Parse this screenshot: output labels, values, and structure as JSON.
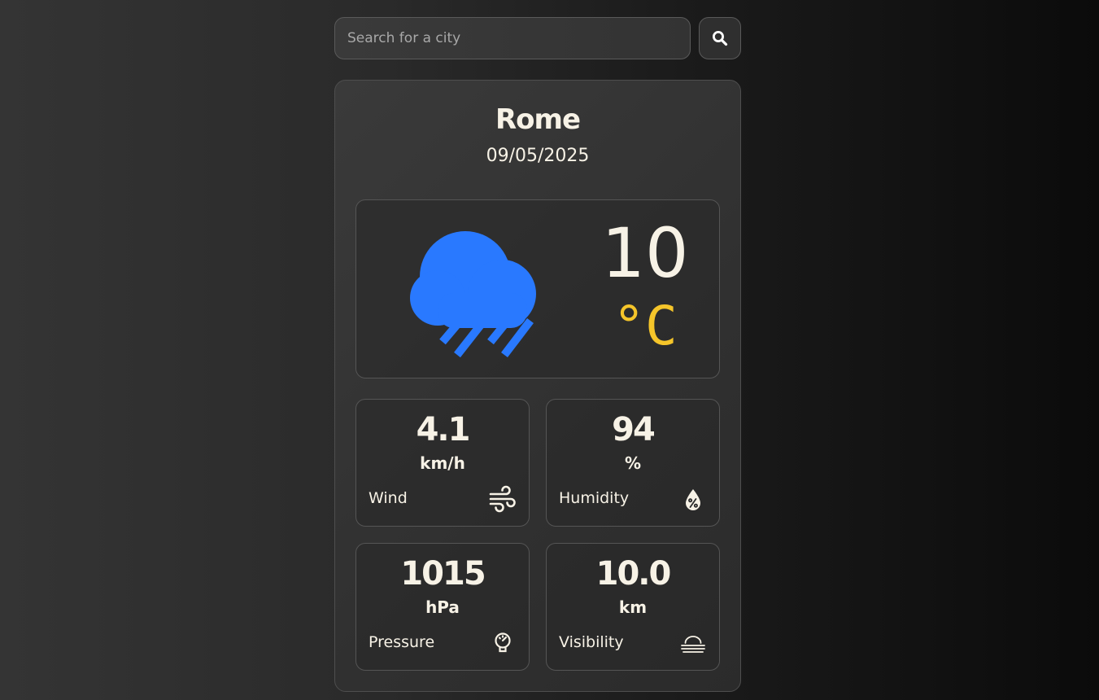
{
  "search": {
    "placeholder": "Search for a city",
    "button_icon": "search-icon"
  },
  "weather": {
    "city": "Rome",
    "date": "09/05/2025",
    "condition_icon": "cloud-rain-icon",
    "temperature": "10",
    "temperature_unit": "°C"
  },
  "stats": {
    "wind": {
      "value": "4.1",
      "unit": "km/h",
      "label": "Wind",
      "icon": "wind-icon"
    },
    "humidity": {
      "value": "94",
      "unit": "%",
      "label": "Humidity",
      "icon": "humidity-drop-icon"
    },
    "pressure": {
      "value": "1015",
      "unit": "hPa",
      "label": "Pressure",
      "icon": "gauge-icon"
    },
    "visibility": {
      "value": "10.0",
      "unit": "km",
      "label": "Visibility",
      "icon": "fog-icon"
    }
  },
  "colors": {
    "rain_icon": "#2979ff",
    "temperature_unit": "#f5c52a",
    "text": "#f7f2e6"
  }
}
